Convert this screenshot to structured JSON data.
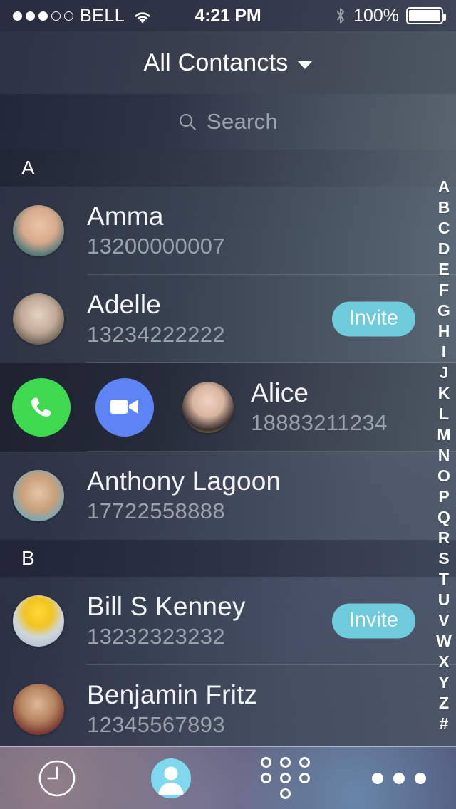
{
  "status_bar": {
    "signal_dots_total": 5,
    "signal_dots_filled": 3,
    "carrier": "BELL",
    "wifi_icon": "wifi-icon",
    "time": "4:21 PM",
    "bluetooth_icon": "bluetooth-icon",
    "battery_percent": "100%",
    "battery_icon": "battery-full-icon"
  },
  "nav": {
    "title": "All Contancts",
    "caret_icon": "chevron-down-icon"
  },
  "search": {
    "placeholder": "Search",
    "value": "",
    "icon": "search-icon"
  },
  "colors": {
    "invite": "#6ecbdc",
    "call": "#3ed94f",
    "video": "#5d84f5",
    "accent_tab": "#7fd8ed",
    "name_text": "#f2f4f6",
    "number_text": "#9aa2ab"
  },
  "sections": [
    {
      "letter": "A",
      "contacts": [
        {
          "name": "Amma",
          "number": "13200000007",
          "avatar": "photo-woman-selfie",
          "invite_label": null,
          "expanded": false
        },
        {
          "name": "Adelle",
          "number": "13234222222",
          "avatar": "photo-woman-portrait",
          "invite_label": "Invite",
          "expanded": false
        },
        {
          "name": "Alice",
          "number": "18883211234",
          "avatar": "photo-woman-bangs",
          "invite_label": null,
          "expanded": true,
          "actions": [
            {
              "name": "call-button",
              "icon": "phone-icon"
            },
            {
              "name": "video-call-button",
              "icon": "video-camera-icon"
            }
          ]
        },
        {
          "name": "Anthony Lagoon",
          "number": "17722558888",
          "avatar": "photo-man-headband",
          "invite_label": null,
          "expanded": false
        }
      ]
    },
    {
      "letter": "B",
      "contacts": [
        {
          "name": "Bill S Kenney",
          "number": "13232323232",
          "avatar": "photo-lego-head",
          "invite_label": "Invite",
          "expanded": false
        },
        {
          "name": "Benjamin Fritz",
          "number": "12345567893",
          "avatar": "photo-man-beard",
          "invite_label": null,
          "expanded": false
        }
      ]
    }
  ],
  "alpha_index": [
    "A",
    "B",
    "C",
    "D",
    "E",
    "F",
    "G",
    "H",
    "I",
    "J",
    "K",
    "L",
    "M",
    "N",
    "O",
    "P",
    "Q",
    "R",
    "S",
    "T",
    "U",
    "V",
    "W",
    "X",
    "Y",
    "Z",
    "#"
  ],
  "tabs": [
    {
      "name": "tab-recents",
      "icon": "clock-icon",
      "active": false
    },
    {
      "name": "tab-contacts",
      "icon": "person-icon",
      "active": true
    },
    {
      "name": "tab-keypad",
      "icon": "dialpad-icon",
      "active": false
    },
    {
      "name": "tab-more",
      "icon": "ellipsis-icon",
      "active": false
    }
  ]
}
